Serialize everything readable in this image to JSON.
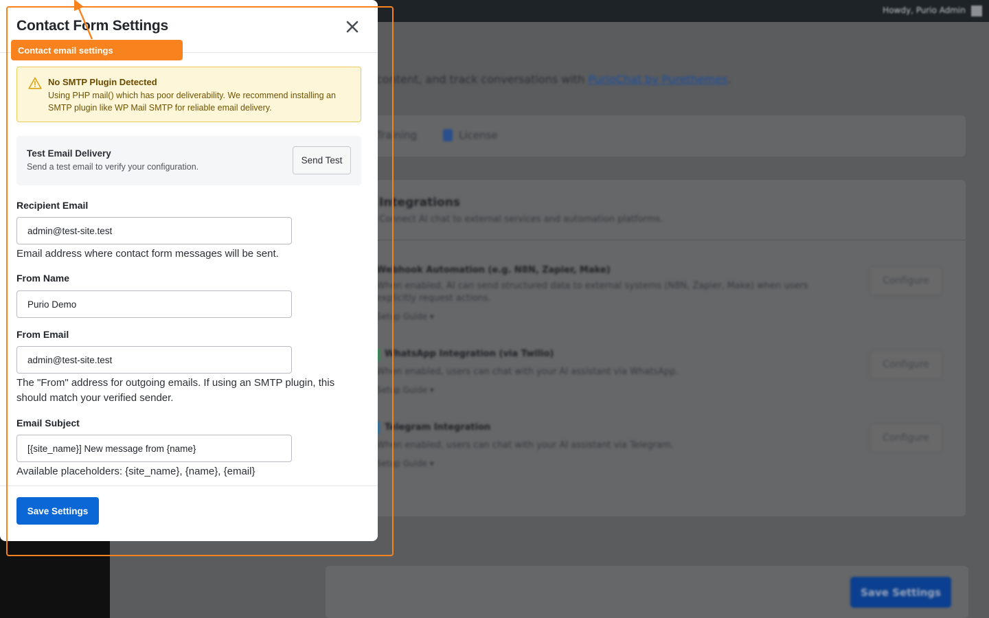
{
  "background": {
    "adminbar_greeting": "Howdy, Purio Admin",
    "intro_prefix": "content, and track conversations with",
    "intro_link": "PurioChat by Purethemes",
    "intro_suffix": ".",
    "tabs": {
      "training": "Training",
      "license": "License"
    },
    "integrations": {
      "title": "Integrations",
      "subtitle": "Connect AI chat to external services and automation platforms.",
      "rows": [
        {
          "title": "Webhook Automation (e.g. N8N, Zapier, Make)",
          "desc": "When enabled, AI can send structured data to external systems (N8N, Zapier, Make) when users explicitly request actions.",
          "guide": "Setup Guide ▾",
          "button": "Configure",
          "accent": "#3a3b3c"
        },
        {
          "title": "WhatsApp Integration (via Twilio)",
          "desc": "When enabled, users can chat with your AI assistant via WhatsApp.",
          "guide": "Setup Guide ▾",
          "button": "Configure",
          "accent": "#2f8a4f"
        },
        {
          "title": "Telegram Integration",
          "desc": "When enabled, users can chat with your AI assistant via Telegram.",
          "guide": "Setup Guide ▾",
          "button": "Configure",
          "accent": "#2d6e9e"
        }
      ]
    },
    "save_label": "Save Settings"
  },
  "modal": {
    "title": "Contact Form Settings",
    "close_icon": "close-icon",
    "warning": {
      "icon": "warning-triangle-icon",
      "title": "No SMTP Plugin Detected",
      "text": "Using PHP mail() which has poor deliverability. We recommend installing an SMTP plugin like WP Mail SMTP for reliable email delivery."
    },
    "test_email": {
      "title": "Test Email Delivery",
      "description": "Send a test email to verify your configuration.",
      "button": "Send Test"
    },
    "fields": {
      "recipient_email": {
        "label": "Recipient Email",
        "value": "admin@test-site.test",
        "help": "Email address where contact form messages will be sent."
      },
      "from_name": {
        "label": "From Name",
        "value": "Purio Demo"
      },
      "from_email": {
        "label": "From Email",
        "value": "admin@test-site.test",
        "help": "The \"From\" address for outgoing emails. If using an SMTP plugin, this should match your verified sender."
      },
      "email_subject": {
        "label": "Email Subject",
        "value": "[{site_name}] New message from {name}",
        "help": "Available placeholders: {site_name}, {name}, {email}"
      }
    },
    "save_button": "Save Settings"
  },
  "annotation": {
    "label": "Contact email settings",
    "color": "#f7821e"
  },
  "colors": {
    "primary": "#0b66d6",
    "warning_bg": "#fdf6d8",
    "warning_border": "#e8cd5b",
    "warning_text": "#6a4a00"
  }
}
